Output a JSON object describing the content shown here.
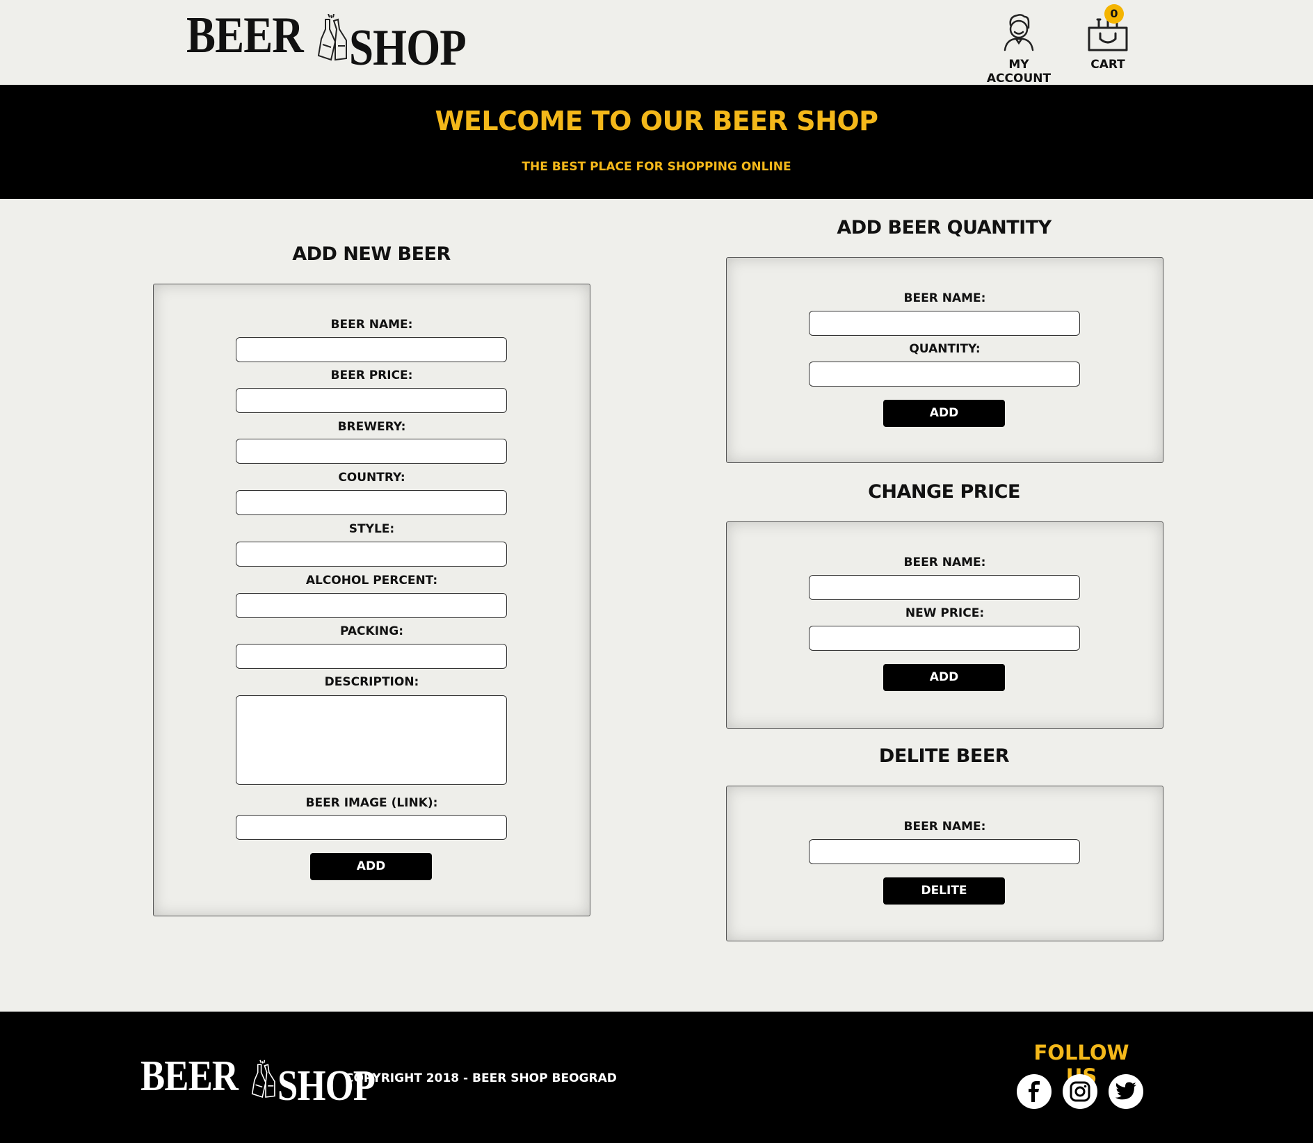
{
  "header": {
    "logo_word1": "BEER",
    "logo_word2": "SHOP",
    "account_label": "MY ACCOUNT",
    "cart_label": "CART",
    "cart_count": "0"
  },
  "banner": {
    "title": "WELCOME TO OUR BEER SHOP",
    "subtitle": "THE BEST PLACE FOR SHOPPING ONLINE"
  },
  "add_new_beer": {
    "title": "ADD NEW BEER",
    "fields": [
      {
        "label": "BEER NAME:",
        "value": ""
      },
      {
        "label": "BEER PRICE:",
        "value": ""
      },
      {
        "label": "BREWERY:",
        "value": ""
      },
      {
        "label": "COUNTRY:",
        "value": ""
      },
      {
        "label": "STYLE:",
        "value": ""
      },
      {
        "label": "ALCOHOL PERCENT:",
        "value": ""
      },
      {
        "label": "PACKING:",
        "value": ""
      },
      {
        "label": "DESCRIPTION:",
        "value": ""
      },
      {
        "label": "BEER IMAGE (LINK):",
        "value": ""
      }
    ],
    "button": "ADD"
  },
  "add_quantity": {
    "title": "ADD BEER QUANTITY",
    "fields": [
      {
        "label": "BEER NAME:",
        "value": ""
      },
      {
        "label": "QUANTITY:",
        "value": ""
      }
    ],
    "button": "ADD"
  },
  "change_price": {
    "title": "CHANGE PRICE",
    "fields": [
      {
        "label": "BEER NAME:",
        "value": ""
      },
      {
        "label": "NEW PRICE:",
        "value": ""
      }
    ],
    "button": "ADD"
  },
  "delete_beer": {
    "title": "DELITE BEER",
    "fields": [
      {
        "label": "BEER NAME:",
        "value": ""
      }
    ],
    "button": "DELITE"
  },
  "footer": {
    "logo_word1": "BEER",
    "logo_word2": "SHOP",
    "copyright": "COPYRIGHT 2018 - BEER SHOP BEOGRAD",
    "follow_us": "FOLLOW US",
    "social": [
      "facebook-icon",
      "instagram-icon",
      "twitter-icon"
    ]
  },
  "colors": {
    "accent": "#f4b81a",
    "background": "#efefeb",
    "dark": "#000000"
  }
}
